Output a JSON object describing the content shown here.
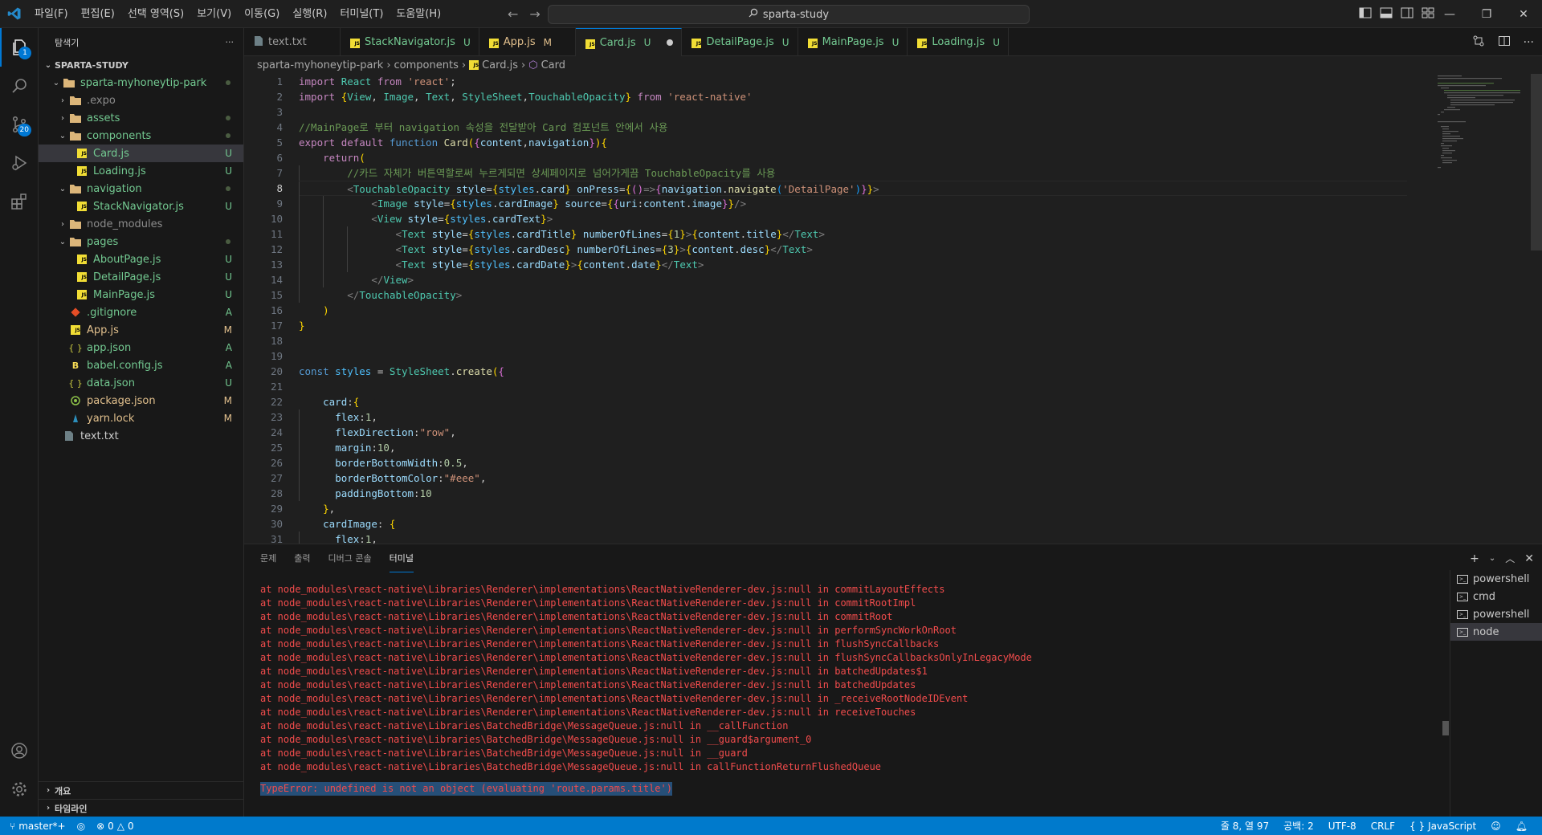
{
  "titlebar": {
    "menu": [
      "파일(F)",
      "편집(E)",
      "선택 영역(S)",
      "보기(V)",
      "이동(G)",
      "실행(R)",
      "터미널(T)",
      "도움말(H)"
    ],
    "search": "sparta-study"
  },
  "activitybar": {
    "explorer_badge": "1",
    "scm_badge": "20"
  },
  "sidebar": {
    "title": "탐색기",
    "more": "···",
    "workspace": "SPARTA-STUDY",
    "tree": [
      {
        "label": "sparta-myhoneytip-park",
        "type": "folder-open",
        "indent": 1,
        "status": "dot",
        "color": "c-green"
      },
      {
        "label": ".expo",
        "type": "folder",
        "indent": 2,
        "status": "",
        "color": "c-grey"
      },
      {
        "label": "assets",
        "type": "folder",
        "indent": 2,
        "status": "dot",
        "color": "c-green"
      },
      {
        "label": "components",
        "type": "folder-open",
        "indent": 2,
        "status": "dot",
        "color": "c-green"
      },
      {
        "label": "Card.js",
        "type": "js",
        "indent": 3,
        "status": "U",
        "color": "c-green",
        "selected": true
      },
      {
        "label": "Loading.js",
        "type": "js",
        "indent": 3,
        "status": "U",
        "color": "c-green"
      },
      {
        "label": "navigation",
        "type": "folder-open",
        "indent": 2,
        "status": "dot",
        "color": "c-green"
      },
      {
        "label": "StackNavigator.js",
        "type": "js",
        "indent": 3,
        "status": "U",
        "color": "c-green"
      },
      {
        "label": "node_modules",
        "type": "folder",
        "indent": 2,
        "status": "",
        "color": "c-grey"
      },
      {
        "label": "pages",
        "type": "folder-open",
        "indent": 2,
        "status": "dot",
        "color": "c-green"
      },
      {
        "label": "AboutPage.js",
        "type": "js",
        "indent": 3,
        "status": "U",
        "color": "c-green"
      },
      {
        "label": "DetailPage.js",
        "type": "js",
        "indent": 3,
        "status": "U",
        "color": "c-green"
      },
      {
        "label": "MainPage.js",
        "type": "js",
        "indent": 3,
        "status": "U",
        "color": "c-green"
      },
      {
        "label": ".gitignore",
        "type": "git",
        "indent": 2,
        "status": "A",
        "color": "c-green"
      },
      {
        "label": "App.js",
        "type": "js",
        "indent": 2,
        "status": "M",
        "color": "c-yellow"
      },
      {
        "label": "app.json",
        "type": "json",
        "indent": 2,
        "status": "A",
        "color": "c-green"
      },
      {
        "label": "babel.config.js",
        "type": "babel",
        "indent": 2,
        "status": "A",
        "color": "c-green"
      },
      {
        "label": "data.json",
        "type": "json",
        "indent": 2,
        "status": "U",
        "color": "c-green"
      },
      {
        "label": "package.json",
        "type": "npm",
        "indent": 2,
        "status": "M",
        "color": "c-yellow"
      },
      {
        "label": "yarn.lock",
        "type": "yarn",
        "indent": 2,
        "status": "M",
        "color": "c-yellow"
      },
      {
        "label": "text.txt",
        "type": "txt",
        "indent": 1,
        "status": "",
        "color": "c-plain"
      }
    ],
    "outline": "개요",
    "timeline": "타임라인"
  },
  "tabs": [
    {
      "label": "text.txt",
      "status": "",
      "icon": "txt"
    },
    {
      "label": "StackNavigator.js",
      "status": "U",
      "icon": "js"
    },
    {
      "label": "App.js",
      "status": "M",
      "icon": "js"
    },
    {
      "label": "Card.js",
      "status": "U",
      "icon": "js",
      "active": true,
      "modified": true
    },
    {
      "label": "DetailPage.js",
      "status": "U",
      "icon": "js"
    },
    {
      "label": "MainPage.js",
      "status": "U",
      "icon": "js"
    },
    {
      "label": "Loading.js",
      "status": "U",
      "icon": "js"
    }
  ],
  "breadcrumb": {
    "root": "sparta-myhoneytip-park",
    "folder": "components",
    "file": "Card.js",
    "symbol": "Card"
  },
  "editor": {
    "current_line": 8,
    "lines": [
      "import React from 'react';",
      "import {View, Image, Text, StyleSheet,TouchableOpacity} from 'react-native'",
      "",
      "//MainPage로 부터 navigation 속성을 전달받아 Card 컴포넌트 안에서 사용",
      "export default function Card({content,navigation}){",
      "    return(",
      "        //카드 자체가 버튼역할로써 누르게되면 상세페이지로 넘어가게끔 TouchableOpacity를 사용",
      "        <TouchableOpacity style={styles.card} onPress={()=>{navigation.navigate('DetailPage')}}>",
      "            <Image style={styles.cardImage} source={{uri:content.image}}/>",
      "            <View style={styles.cardText}>",
      "                <Text style={styles.cardTitle} numberOfLines={1}>{content.title}</Text>",
      "                <Text style={styles.cardDesc} numberOfLines={3}>{content.desc}</Text>",
      "                <Text style={styles.cardDate}>{content.date}</Text>",
      "            </View>",
      "        </TouchableOpacity>",
      "    )",
      "}",
      "",
      "",
      "const styles = StyleSheet.create({",
      "",
      "    card:{",
      "      flex:1,",
      "      flexDirection:\"row\",",
      "      margin:10,",
      "      borderBottomWidth:0.5,",
      "      borderBottomColor:\"#eee\",",
      "      paddingBottom:10",
      "    },",
      "    cardImage: {",
      "      flex:1,"
    ]
  },
  "panel": {
    "tabs": [
      "문제",
      "출력",
      "디버그 콘솔",
      "터미널"
    ],
    "active_tab": "터미널",
    "terminal_lines": [
      "at node_modules\\react-native\\Libraries\\Renderer\\implementations\\ReactNativeRenderer-dev.js:null in commitLayoutEffects",
      "at node_modules\\react-native\\Libraries\\Renderer\\implementations\\ReactNativeRenderer-dev.js:null in commitRootImpl",
      "at node_modules\\react-native\\Libraries\\Renderer\\implementations\\ReactNativeRenderer-dev.js:null in commitRoot",
      "at node_modules\\react-native\\Libraries\\Renderer\\implementations\\ReactNativeRenderer-dev.js:null in performSyncWorkOnRoot",
      "at node_modules\\react-native\\Libraries\\Renderer\\implementations\\ReactNativeRenderer-dev.js:null in flushSyncCallbacks",
      "at node_modules\\react-native\\Libraries\\Renderer\\implementations\\ReactNativeRenderer-dev.js:null in flushSyncCallbacksOnlyInLegacyMode",
      "at node_modules\\react-native\\Libraries\\Renderer\\implementations\\ReactNativeRenderer-dev.js:null in batchedUpdates$1",
      "at node_modules\\react-native\\Libraries\\Renderer\\implementations\\ReactNativeRenderer-dev.js:null in batchedUpdates",
      "at node_modules\\react-native\\Libraries\\Renderer\\implementations\\ReactNativeRenderer-dev.js:null in _receiveRootNodeIDEvent",
      "at node_modules\\react-native\\Libraries\\Renderer\\implementations\\ReactNativeRenderer-dev.js:null in receiveTouches",
      "at node_modules\\react-native\\Libraries\\BatchedBridge\\MessageQueue.js:null in __callFunction",
      "at node_modules\\react-native\\Libraries\\BatchedBridge\\MessageQueue.js:null in __guard$argument_0",
      "at node_modules\\react-native\\Libraries\\BatchedBridge\\MessageQueue.js:null in __guard",
      "at node_modules\\react-native\\Libraries\\BatchedBridge\\MessageQueue.js:null in callFunctionReturnFlushedQueue"
    ],
    "error_line": "TypeError: undefined is not an object (evaluating 'route.params.title')",
    "terminals": [
      "powershell",
      "cmd",
      "powershell",
      "node"
    ],
    "active_terminal": 3
  },
  "statusbar": {
    "branch": "master*+",
    "errors": "0",
    "warnings": "0",
    "position": "줄 8, 열 97",
    "spaces": "공백: 2",
    "encoding": "UTF-8",
    "eol": "CRLF",
    "language": "JavaScript"
  },
  "colors": {
    "accent": "#0078d4",
    "statusbar": "#007acc",
    "untracked": "#73c991",
    "modified": "#e2c08d",
    "error_text": "#f14c4c"
  }
}
